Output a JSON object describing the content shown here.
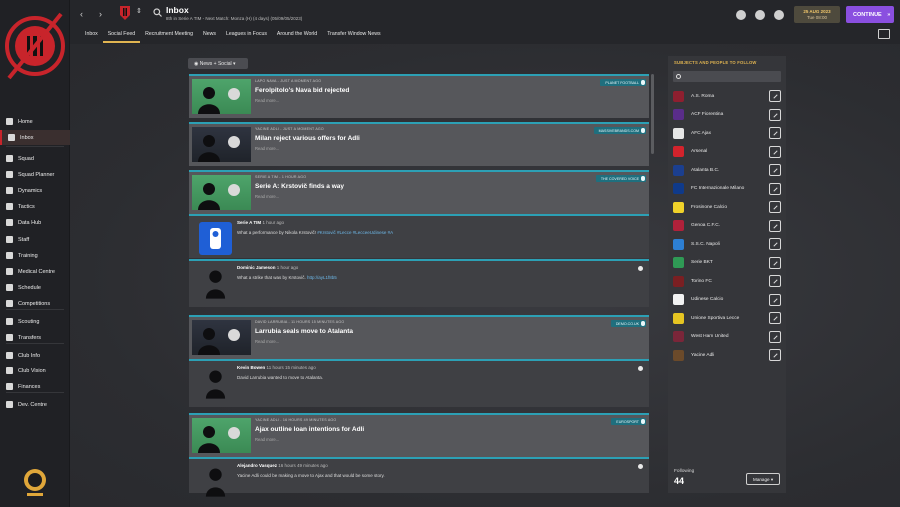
{
  "sidebar": {
    "items": [
      {
        "label": "Home",
        "icon": "home-icon"
      },
      {
        "label": "Inbox",
        "icon": "inbox-icon"
      },
      {
        "label": "Squad",
        "icon": "squad-icon"
      },
      {
        "label": "Squad Planner",
        "icon": "planner-icon"
      },
      {
        "label": "Dynamics",
        "icon": "dynamics-icon"
      },
      {
        "label": "Tactics",
        "icon": "tactics-icon"
      },
      {
        "label": "Data Hub",
        "icon": "data-icon"
      },
      {
        "label": "Staff",
        "icon": "staff-icon"
      },
      {
        "label": "Training",
        "icon": "training-icon"
      },
      {
        "label": "Medical Centre",
        "icon": "medical-icon"
      },
      {
        "label": "Schedule",
        "icon": "schedule-icon"
      },
      {
        "label": "Competitions",
        "icon": "trophy-icon"
      },
      {
        "label": "Scouting",
        "icon": "scouting-icon"
      },
      {
        "label": "Transfers",
        "icon": "transfers-icon"
      },
      {
        "label": "Club Info",
        "icon": "info-icon"
      },
      {
        "label": "Club Vision",
        "icon": "vision-icon"
      },
      {
        "label": "Finances",
        "icon": "finances-icon"
      },
      {
        "label": "Dev. Centre",
        "icon": "dev-icon"
      }
    ],
    "active_index": 1
  },
  "header": {
    "title": "Inbox",
    "subtitle": "8th in Serie A TIM - Next Match: Monza (H) (4 days) (05/09/05/2023)",
    "tabs": [
      "Inbox",
      "Social Feed",
      "Recruitment Meeting",
      "News",
      "Leagues in Focus",
      "Around the World",
      "Transfer Window News"
    ],
    "active_tab": 1,
    "date_line1": "25 AUG 2023",
    "date_line2": "Tue 08:00",
    "continue_label": "CONTINUE"
  },
  "feed": {
    "filter_label": "News + Social",
    "cards": [
      {
        "meta": "LAPO NAVA - JUST A MOMENT AGO",
        "title": "Ferolpitolo's Nava bid rejected",
        "read_more": "Read more...",
        "badge": "PLANET FOOTBALL"
      },
      {
        "meta": "YACINE ADLI - JUST A MOMENT AGO",
        "title": "Milan reject various offers for Adli",
        "read_more": "Read more...",
        "badge": "MASSIVEBRANDS.COM"
      },
      {
        "meta": "SERIE A TIM - 1 HOUR AGO",
        "title": "Serie A: Krstovič finds a way",
        "read_more": "Read more...",
        "badge": "THE COVERED VOICE"
      },
      {
        "meta": "DAVID LARRUBIA - 11 HOURS 15 MINUTES AGO",
        "title": "Larrubia seals move to Atalanta",
        "read_more": "Read more...",
        "badge": "DEMO.CO.UK"
      },
      {
        "meta": "YACINE ADLI - 16 HOURS 49 MINUTES AGO",
        "title": "Ajax outline loan intentions for Adli",
        "read_more": "Read more...",
        "badge": "EUROSPORT"
      }
    ],
    "posts": [
      {
        "author": "Serie A TIM",
        "time": "1 hour ago",
        "text": "What a performance by Nikola Krstovič! ",
        "tags": "#Krstovič #Lecce #LecceeUdinese #A"
      },
      {
        "author": "Dominic Jameson",
        "time": "1 hour ago",
        "text": "What a strike that was by Krstovič. ",
        "tags": "http://ayL1f8b5"
      },
      {
        "author": "Kevin Bowen",
        "time": "11 hours 15 minutes ago",
        "text": "David Larrubia wanted to move to Atalanta.",
        "tags": ""
      },
      {
        "author": "Alejandro Vasquez",
        "time": "16 hours 49 minutes ago",
        "text": "Yacine Adli could be making a move to Ajax and that would be some story.",
        "tags": ""
      }
    ]
  },
  "follow_panel": {
    "title": "SUBJECTS AND PEOPLE TO FOLLOW",
    "clubs": [
      {
        "name": "A.S. Roma",
        "color": "#8e1f2f"
      },
      {
        "name": "ACF Fiorentina",
        "color": "#5a2d8a"
      },
      {
        "name": "AFC Ajax",
        "color": "#e6e6e6"
      },
      {
        "name": "Arsenal",
        "color": "#d3232c"
      },
      {
        "name": "Atalanta B.C.",
        "color": "#1b3f8f"
      },
      {
        "name": "FC Internazionale Milano",
        "color": "#0f3a8a"
      },
      {
        "name": "Frosinone Calcio",
        "color": "#f0d22a"
      },
      {
        "name": "Genoa C.F.C.",
        "color": "#b0213a"
      },
      {
        "name": "S.S.C. Napoli",
        "color": "#2d7fd3"
      },
      {
        "name": "Serie BKT",
        "color": "#2f9a55"
      },
      {
        "name": "Torino FC",
        "color": "#7a1f22"
      },
      {
        "name": "Udinese Calcio",
        "color": "#f2f2f2"
      },
      {
        "name": "Unione Sportiva Lecce",
        "color": "#e6c522"
      },
      {
        "name": "West Ham United",
        "color": "#7a2639"
      },
      {
        "name": "Yacine Adli",
        "color": "#6b4a2a"
      }
    ],
    "following_label": "Following",
    "following_count": "44",
    "manage_label": "Manage"
  }
}
